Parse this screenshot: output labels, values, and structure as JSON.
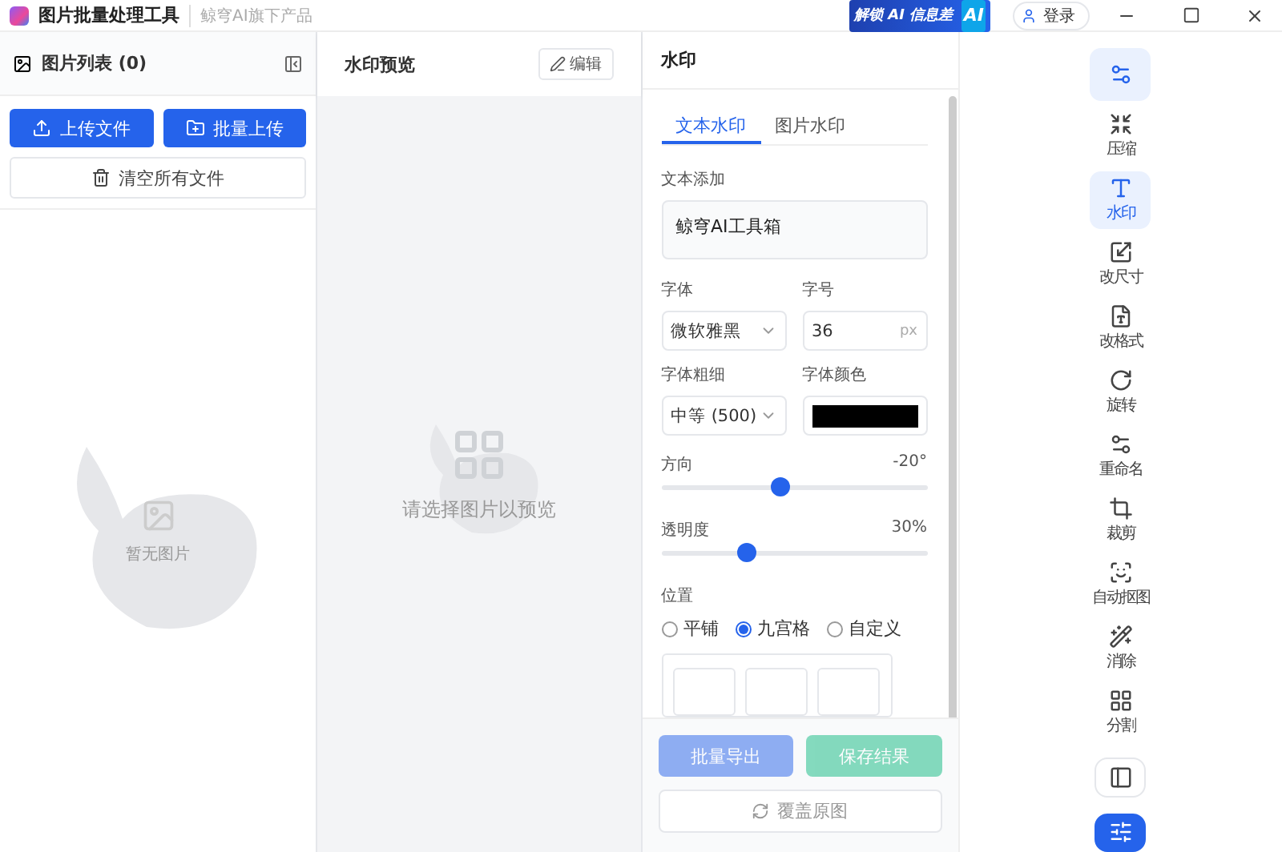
{
  "app": {
    "title": "图片批量处理工具",
    "subtitle": "鲸穹AI旗下产品"
  },
  "banner": {
    "text": "解锁 AI 信息差",
    "badge": "AI"
  },
  "login": "登录",
  "left": {
    "title": "图片列表 (0)",
    "buttons": [
      {
        "label": "上传文件",
        "kind": "upload"
      },
      {
        "label": "批量上传",
        "kind": "folder"
      }
    ],
    "clear": "清空所有文件",
    "empty": "暂无图片"
  },
  "preview": {
    "title": "水印预览",
    "edit": "编辑",
    "empty": "请选择图片以预览"
  },
  "panel": {
    "title": "水印",
    "tabs": [
      {
        "label": "文本水印",
        "selected": true
      },
      {
        "label": "图片水印",
        "selected": false
      }
    ],
    "text_label": "文本添加",
    "text_value": "鲸穹AI工具箱",
    "font_label": "字体",
    "font_value": "微软雅黑",
    "size_label": "字号",
    "size_value": "36",
    "size_unit": "px",
    "weight_label": "字体粗细",
    "weight_value": "中等 (500)",
    "color_label": "字体颜色",
    "sliders": [
      {
        "label": "方向",
        "reading": "-20°",
        "level": 0.45
      },
      {
        "label": "透明度",
        "reading": "30%",
        "level": 0.32
      }
    ],
    "position_label": "位置",
    "positions": [
      {
        "label": "平铺",
        "selected": false
      },
      {
        "label": "九宫格",
        "selected": true
      },
      {
        "label": "自定义",
        "selected": false
      }
    ],
    "actions": [
      {
        "label": "批量导出",
        "kind": "export",
        "disabled": true
      },
      {
        "label": "保存结果",
        "kind": "save",
        "disabled": true
      }
    ],
    "overwrite": "覆盖原图"
  },
  "rail": [
    {
      "kind": "settings",
      "selected": true
    },
    {
      "kind": "compress",
      "label": "压缩",
      "selected": false
    },
    {
      "kind": "text",
      "label": "水印",
      "selected": true
    },
    {
      "kind": "resize",
      "label": "改尺寸",
      "selected": false
    },
    {
      "kind": "format",
      "label": "改格式",
      "selected": false
    },
    {
      "kind": "rotate",
      "label": "旋转",
      "selected": false
    },
    {
      "kind": "rename",
      "label": "重命名",
      "selected": false
    },
    {
      "kind": "crop",
      "label": "裁剪",
      "selected": false
    },
    {
      "kind": "cutout",
      "label": "自动抠图",
      "selected": false
    },
    {
      "kind": "erase",
      "label": "消除",
      "selected": false
    },
    {
      "kind": "split",
      "label": "分割",
      "selected": false
    }
  ],
  "rail_bottom": [
    {
      "kind": "layout",
      "selected": false
    },
    {
      "kind": "adjust",
      "selected": true
    }
  ]
}
